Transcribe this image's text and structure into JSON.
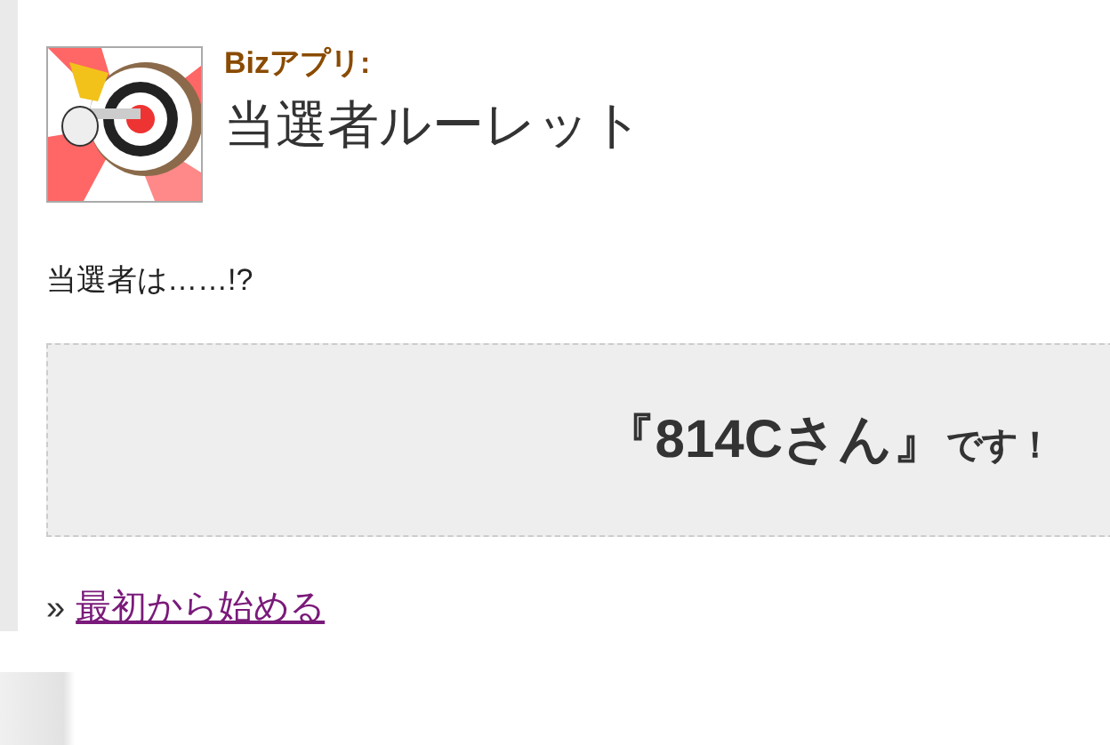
{
  "header": {
    "category": "Bizアプリ:",
    "title": "当選者ルーレット"
  },
  "prompt": "当選者は……!?",
  "result": {
    "winner": "『814Cさん』",
    "suffix": "です！"
  },
  "footer": {
    "marker": "»",
    "link": {
      "label": "最初から始める",
      "visited": true
    }
  }
}
